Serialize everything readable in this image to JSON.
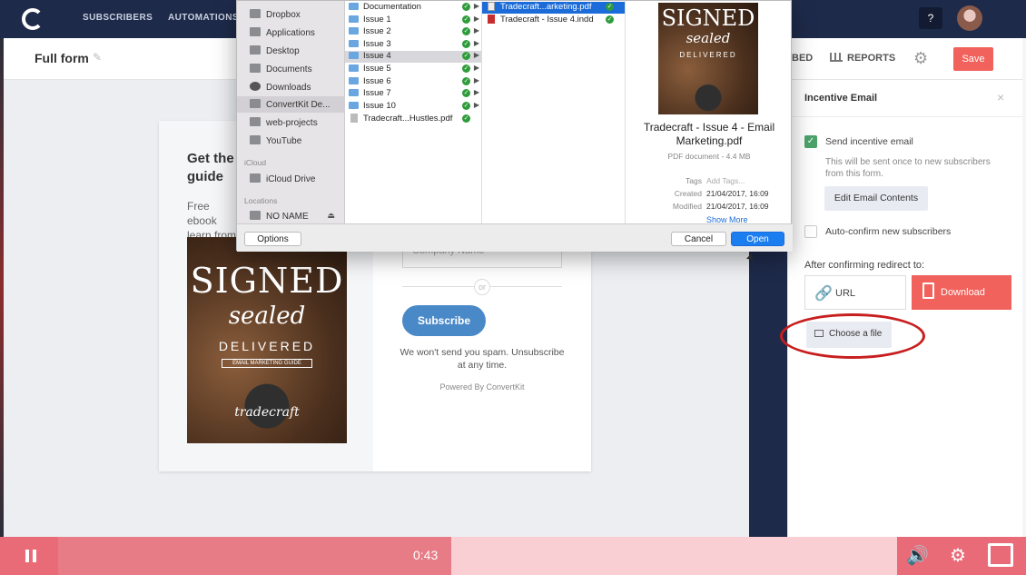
{
  "nav": {
    "items": [
      "SUBSCRIBERS",
      "AUTOMATIONS"
    ],
    "help": "?"
  },
  "subbar": {
    "title": "Full form",
    "tab_partial": "BED",
    "reports": "REPORTS",
    "save": "Save"
  },
  "form_card": {
    "title": "Get the guide",
    "description": "Free ebook learn from",
    "ebook": {
      "signed": "SIGNED",
      "sealed": "sealed",
      "delivered": "DELIVERED",
      "subtitle": "EMAIL MARKETING GUIDE",
      "brand": "tradecraft"
    },
    "company_placeholder": "Company Name",
    "or_label": "or",
    "subscribe": "Subscribe",
    "spam_text": "We won't send you spam. Unsubscribe at any time.",
    "powered": "Powered By ConvertKit"
  },
  "panel": {
    "title": "Incentive Email",
    "close": "×",
    "send_label": "Send incentive email",
    "send_checked": true,
    "hint": "This will be sent once to new subscribers from this form.",
    "edit_button": "Edit Email Contents",
    "auto_confirm": "Auto-confirm new subscribers",
    "auto_confirm_checked": false,
    "redirect_label": "After confirming redirect to:",
    "url_option": "URL",
    "download_option": "Download",
    "choose_file": "Choose a file"
  },
  "dialog": {
    "sidebar": {
      "favorites": [
        "Dropbox",
        "Applications",
        "Desktop",
        "Documents",
        "Downloads",
        "ConvertKit De...",
        "web-projects",
        "YouTube"
      ],
      "selected": "ConvertKit De...",
      "icloud_header": "iCloud",
      "icloud_items": [
        "iCloud Drive"
      ],
      "locations_header": "Locations",
      "locations": [
        "NO NAME"
      ]
    },
    "column1": [
      {
        "name": "Documentation",
        "type": "folder"
      },
      {
        "name": "Issue 1",
        "type": "folder"
      },
      {
        "name": "Issue 2",
        "type": "folder"
      },
      {
        "name": "Issue 3",
        "type": "folder"
      },
      {
        "name": "Issue 4",
        "type": "folder",
        "selected": true
      },
      {
        "name": "Issue 5",
        "type": "folder"
      },
      {
        "name": "Issue 6",
        "type": "folder"
      },
      {
        "name": "Issue 7",
        "type": "folder"
      },
      {
        "name": "Issue 10",
        "type": "folder"
      },
      {
        "name": "Tradecraft...Hustles.pdf",
        "type": "file"
      }
    ],
    "column2": [
      {
        "name": "Tradecraft...arketing.pdf",
        "type": "pdf",
        "selected": true
      },
      {
        "name": "Tradecraft - Issue 4.indd",
        "type": "indd"
      }
    ],
    "preview": {
      "name": "Tradecraft - Issue 4 - Email Marketing.pdf",
      "kind": "PDF document - 4.4 MB",
      "tags_label": "Tags",
      "tags_value": "Add Tags...",
      "created_label": "Created",
      "created_value": "21/04/2017, 16:09",
      "modified_label": "Modified",
      "modified_value": "21/04/2017, 16:09",
      "show_more": "Show More"
    },
    "options": "Options",
    "cancel": "Cancel",
    "open": "Open"
  },
  "player": {
    "time": "0:43",
    "progress": 0.44
  },
  "colors": {
    "nav_bg": "#1e2a4a",
    "accent_red": "#f0625b",
    "subscribe_blue": "#4a89c8",
    "check_green": "#4ba36a",
    "annotation_red": "#c81e1e",
    "player_pink": "#e77b86"
  },
  "icons": [
    "logo-icon",
    "pencil-icon",
    "reports-icon",
    "gear-icon",
    "link-icon",
    "file-icon",
    "image-icon",
    "pause-icon",
    "volume-icon",
    "settings-icon",
    "fullscreen-icon"
  ]
}
